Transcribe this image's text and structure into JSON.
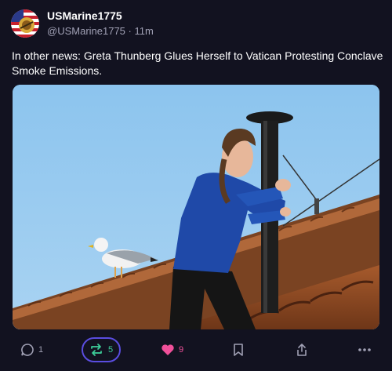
{
  "author": {
    "name": "USMarine1775",
    "handle": "@USMarine1775",
    "time": "11m",
    "avatar_icon": "american-flag-marine-emblem-icon"
  },
  "post": {
    "text": "In other news: Greta Thunberg Glues Herself to Vatican Protesting Conclave Smoke Emissions.",
    "image_icon": "photo-woman-hugging-chimney-on-roof-with-seagull"
  },
  "actions": {
    "reply_count": "1",
    "repost_count": "5",
    "like_count": "9"
  },
  "colors": {
    "background": "#121220",
    "repost_accent": "#5a4de0",
    "repost_icon": "#3ecf9a",
    "like": "#f0509a",
    "muted": "#a0a0b4"
  }
}
